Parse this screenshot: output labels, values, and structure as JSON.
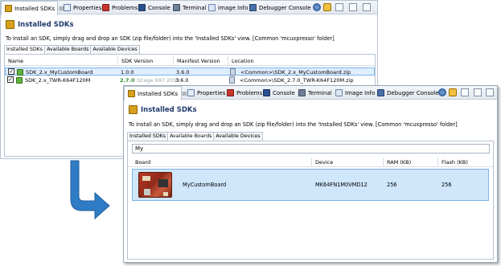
{
  "w1": {
    "tabs": [
      "Installed SDKs",
      "Properties",
      "Problems",
      "Console",
      "Terminal",
      "Image Info",
      "Debugger Console"
    ],
    "close_glyph": "☒",
    "toolbar_icons": [
      "globe-icon",
      "sdk-import-icon",
      "view-menu-icon",
      "minimize-icon",
      "maximize-icon"
    ],
    "heading": "Installed SDKs",
    "instruction": "To install an SDK, simply drag and drop an SDK (zip file/folder) into the 'Installed SDKs' view. [Common 'mcuxpresso' folder]",
    "subtabs": [
      "Installed SDKs",
      "Available Boards",
      "Available Devices"
    ],
    "columns": [
      "Name",
      "SDK Version",
      "Manifest Version",
      "Location"
    ],
    "rows": [
      {
        "checked": "✓",
        "name": "SDK_2.x_MyCustomBoard",
        "sdk_version": "1.0.0",
        "sdk_extra": "",
        "manifest": "3.6.0",
        "location": "<Common>\\SDK_2.x_MyCustomBoard.zip"
      },
      {
        "checked": "✓",
        "name": "SDK_2.x_TWR-K64F120M",
        "sdk_version": "2.7.0",
        "sdk_extra": "(stage 697 2019",
        "manifest": "3.6.0",
        "location": "<Common>\\SDK_2.7.0_TWR-K64F120M.zip"
      }
    ]
  },
  "w2": {
    "tabs": [
      "Installed SDKs",
      "Properties",
      "Problems",
      "Console",
      "Terminal",
      "Image Info",
      "Debugger Console"
    ],
    "close_glyph": "☒",
    "heading": "Installed SDKs",
    "instruction": "To install an SDK, simply drag and drop an SDK (zip file/folder) into the 'Installed SDKs' view. [Common 'mcuxpresso' folder]",
    "subtabs": [
      "Installed SDKs",
      "Available Boards",
      "Available Devices"
    ],
    "search_value": "My",
    "columns": [
      "Board",
      "Device",
      "RAM (KB)",
      "Flash (KB)"
    ],
    "board": {
      "name": "MyCustomBoard",
      "device": "MK64FN1M0VMD12",
      "ram": "256",
      "flash": "256"
    }
  },
  "colors": {
    "accent": "#1f3a6b",
    "selection": "#cfe6fb",
    "arrow": "#2f7cc6"
  }
}
